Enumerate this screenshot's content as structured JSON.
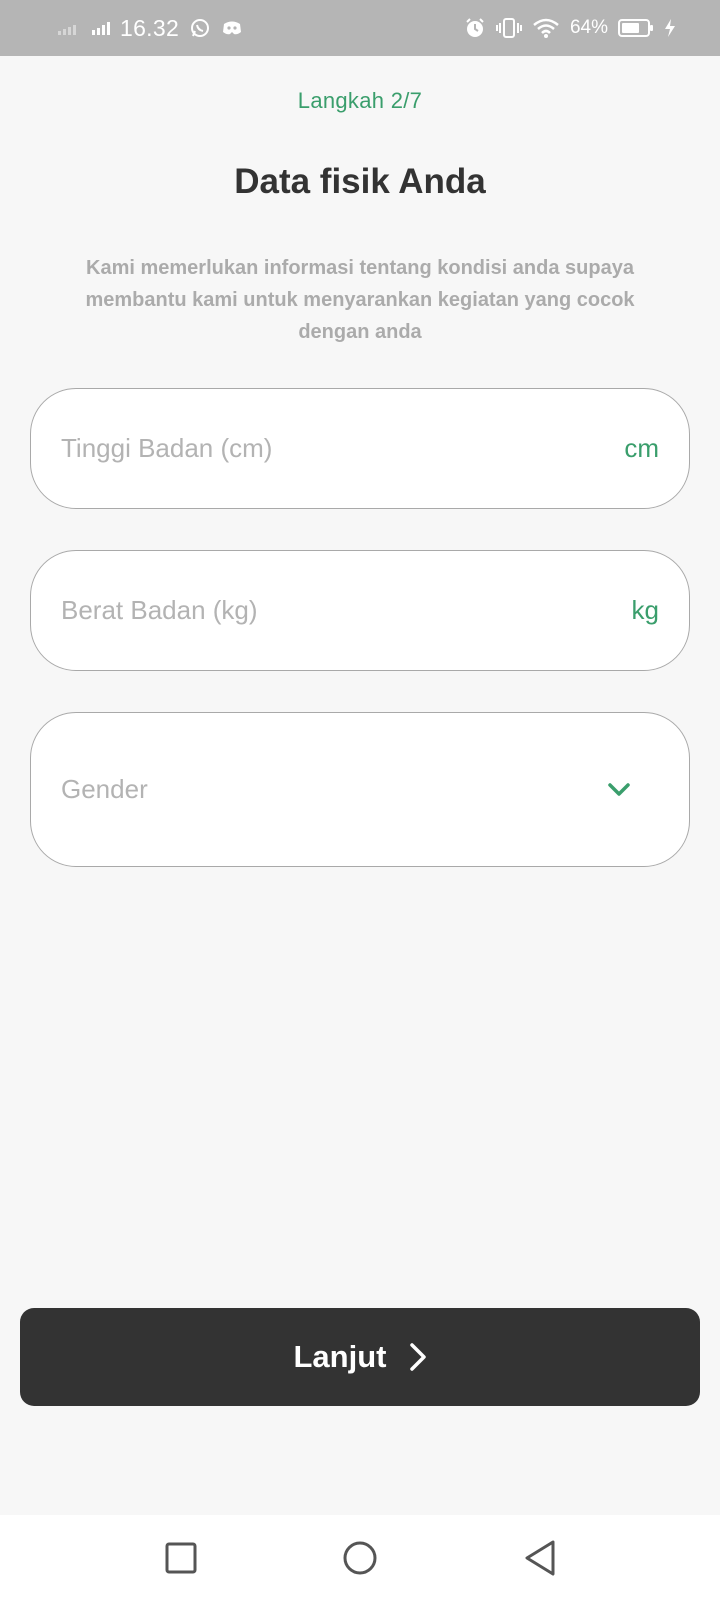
{
  "status_bar": {
    "time": "16.32",
    "battery_percent": "64%",
    "icons": [
      "signal-icon",
      "whatsapp-icon",
      "discord-icon",
      "alarm-icon",
      "vibrate-icon",
      "wifi-icon",
      "battery-icon",
      "charging-icon"
    ]
  },
  "header": {
    "step": "Langkah 2/7",
    "title": "Data fisik Anda",
    "description": "Kami memerlukan informasi tentang kondisi anda supaya membantu kami untuk menyarankan kegiatan yang cocok dengan anda"
  },
  "form": {
    "height": {
      "placeholder": "Tinggi Badan (cm)",
      "value": "",
      "unit": "cm"
    },
    "weight": {
      "placeholder": "Berat Badan (kg)",
      "value": "",
      "unit": "kg"
    },
    "gender": {
      "placeholder": "Gender"
    }
  },
  "actions": {
    "next_label": "Lanjut"
  },
  "nav_bar": {
    "icons": [
      "recent-apps-icon",
      "home-icon",
      "back-icon"
    ]
  },
  "colors": {
    "accent": "#3a9e6c",
    "button": "#333333",
    "background": "#f7f7f7",
    "status_bar": "#b5b5b5"
  }
}
